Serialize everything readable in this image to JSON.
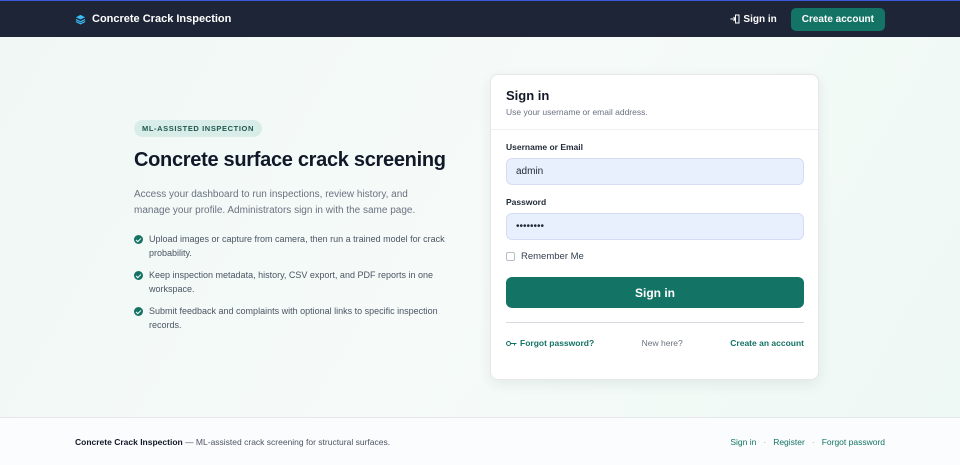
{
  "header": {
    "brand": "Concrete Crack Inspection",
    "signin": "Sign in",
    "create_account": "Create account"
  },
  "hero": {
    "badge": "ML-ASSISTED INSPECTION",
    "title": "Concrete surface crack screening",
    "description": "Access your dashboard to run inspections, review history, and manage your profile. Administrators sign in with the same page.",
    "features": [
      "Upload images or capture from camera, then run a trained model for crack probability.",
      "Keep inspection metadata, history, CSV export, and PDF reports in one workspace.",
      "Submit feedback and complaints with optional links to specific inspection records."
    ]
  },
  "login": {
    "title": "Sign in",
    "subtitle": "Use your username or email address.",
    "username_label": "Username or Email",
    "username_value": "admin",
    "password_label": "Password",
    "password_value": "••••••••",
    "remember_label": "Remember Me",
    "submit_label": "Sign in",
    "forgot_label": "Forgot password?",
    "new_here": "New here?",
    "create_label": "Create an account"
  },
  "footer": {
    "brand": "Concrete Crack Inspection",
    "tagline": " — ML-assisted crack screening for structural surfaces.",
    "links": [
      "Sign in",
      "Register",
      "Forgot password"
    ],
    "separator": "·"
  },
  "colors": {
    "nav_bg": "#1e2537",
    "accent": "#137364",
    "input_bg": "#e8effd"
  },
  "icons": {
    "brand": "layers-icon",
    "signin": "login-icon",
    "check": "check-circle-icon",
    "forgot": "key-icon"
  }
}
